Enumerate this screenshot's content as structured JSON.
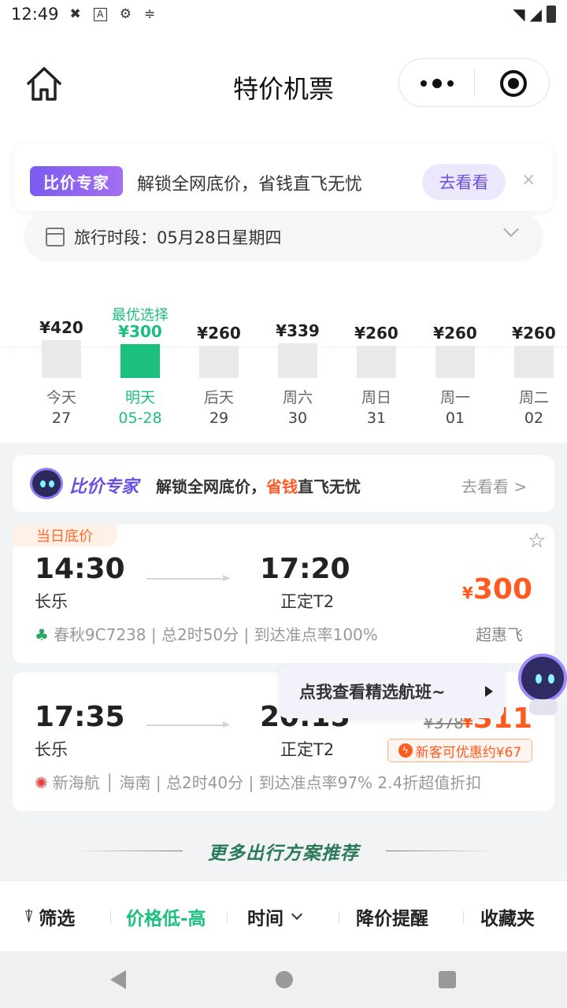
{
  "status_bar": {
    "time": "12:49",
    "icons": [
      "tools-icon",
      "a-icon",
      "gear-icon",
      "data-icon"
    ],
    "right_icons": [
      "wifi-icon",
      "signal-icon",
      "battery-icon"
    ]
  },
  "header": {
    "title": "特价机票",
    "home_icon": "home-icon",
    "menu_icon": "more-dots-icon",
    "close_icon": "target-icon"
  },
  "promo_banner": {
    "badge": "比价专家",
    "text": "解锁全网底价，省钱直飞无忧",
    "button": "去看看",
    "close": "×"
  },
  "date_selector": {
    "text": "旅行时段：05月28日星期四"
  },
  "calendar": {
    "best_label": "最优选择",
    "days": [
      {
        "price": "¥420",
        "label": "今天",
        "date": "27",
        "level": 0.71,
        "selected": false
      },
      {
        "price": "¥300",
        "label": "明天",
        "date": "05-28",
        "level": 0.63,
        "selected": true
      },
      {
        "price": "¥260",
        "label": "后天",
        "date": "29",
        "level": 0.6,
        "selected": false
      },
      {
        "price": "¥339",
        "label": "周六",
        "date": "30",
        "level": 0.65,
        "selected": false
      },
      {
        "price": "¥260",
        "label": "周日",
        "date": "31",
        "level": 0.6,
        "selected": false
      },
      {
        "price": "¥260",
        "label": "周一",
        "date": "01",
        "level": 0.6,
        "selected": false
      },
      {
        "price": "¥260",
        "label": "周二",
        "date": "02",
        "level": 0.6,
        "selected": false
      }
    ]
  },
  "expert_card": {
    "brand": "比价专家",
    "text_before": "解锁全网底价，",
    "text_highlight": "省钱",
    "text_after": "直飞无忧",
    "link": "去看看 >"
  },
  "flights": [
    {
      "tag": "当日底价",
      "dep_time": "14:30",
      "dep_city": "长乐",
      "arr_time": "17:20",
      "arr_city": "正定T2",
      "currency": "¥",
      "price": "300",
      "meta": "春秋9C7238 | 总2时50分 | 到达准点率100%",
      "note": "超惠飞"
    },
    {
      "dep_time": "17:35",
      "dep_city": "长乐",
      "arr_time": "20:15",
      "arr_city": "正定T2",
      "old_price": "¥378",
      "currency": "¥",
      "price": "311",
      "coupon": "新客可优惠约¥67",
      "meta": "新海航 │ 海南 | 总2时40分 | 到达准点率97%  2.4折超值折扣"
    }
  ],
  "tooltip": {
    "text": "点我查看精选航班~"
  },
  "more_plans": {
    "text": "更多出行方案推荐"
  },
  "bottom_bar": {
    "filter": "筛选",
    "price_sort": "价格低-高",
    "time": "时间",
    "price_alert": "降价提醒",
    "favorites": "收藏夹"
  },
  "colors": {
    "accent_green": "#1bbf7e",
    "price_orange": "#ff5a1f",
    "expert_purple": "#6d4fe0"
  }
}
